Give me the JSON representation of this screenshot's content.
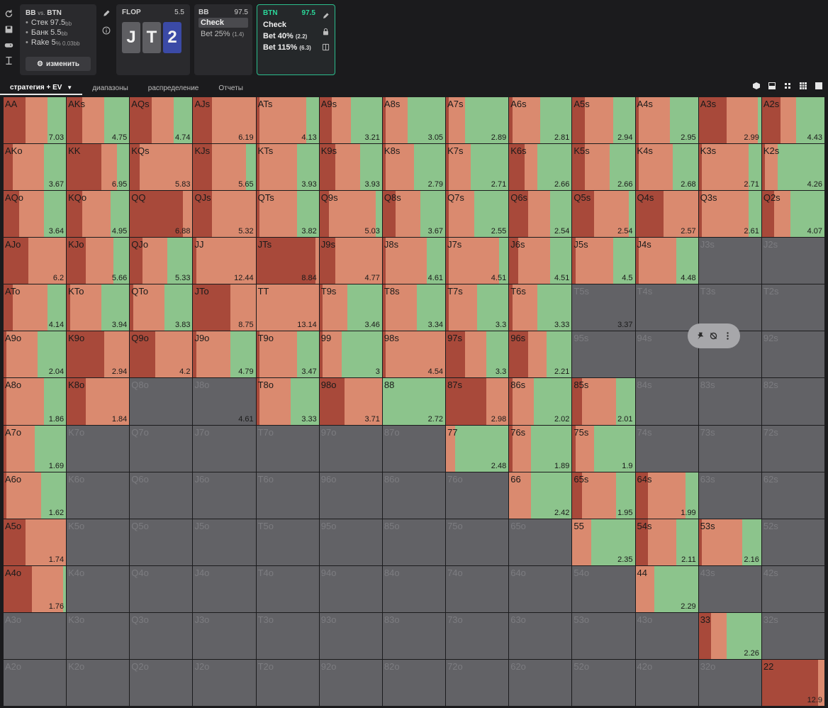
{
  "game": {
    "title": "BB",
    "title_sep": "vs.",
    "title_end": "BTN",
    "lines": [
      {
        "label": "Стек 97.5",
        "unit": "bb"
      },
      {
        "label": "Банк 5.5",
        "unit": "bb"
      },
      {
        "label": "Rake 5",
        "unit": "% 0.03bb"
      }
    ],
    "edit_label": "изменить"
  },
  "flop": {
    "label": "FLOP",
    "pot": "5.5",
    "cards": [
      {
        "rank": "J",
        "suit": "none"
      },
      {
        "rank": "T",
        "suit": "none"
      },
      {
        "rank": "2",
        "suit": "diamond"
      }
    ]
  },
  "bb_node": {
    "label": "BB",
    "stack": "97.5",
    "actions": [
      {
        "label": "Check",
        "size": "",
        "active": true
      },
      {
        "label": "Bet 25%",
        "size": "(1.4)",
        "active": false
      }
    ]
  },
  "btn_node": {
    "label": "BTN",
    "stack": "97.5",
    "actions": [
      {
        "label": "Check",
        "size": ""
      },
      {
        "label": "Bet 40%",
        "size": "(2.2)"
      },
      {
        "label": "Bet 115%",
        "size": "(6.3)"
      }
    ]
  },
  "tabs": [
    {
      "label": "стратегия + EV",
      "active": true
    },
    {
      "label": "диапазоны",
      "active": false
    },
    {
      "label": "распределение",
      "active": false
    },
    {
      "label": "Отчеты",
      "active": false
    }
  ],
  "colors": {
    "bet115": "#a8493a",
    "bet40": "#da8a6f",
    "check": "#8cc48c",
    "excluded": "#626266",
    "accent": "#2bbd8c"
  },
  "grid": {
    "rows": [
      [
        "AA|7.03|0.35,0.35,0.30",
        "AKs|4.75|0.25,0.35,0.40",
        "AQs|4.74|0.35,0.35,0.30",
        "AJs|6.19|0.30,0.70,0.0",
        "ATs|4.13|0.05,0.75,0.20",
        "A9s|3.21|0.20,0.30,0.50",
        "A8s|3.05|0.05,0.35,0.60",
        "A7s|2.89|0.05,0.25,0.70",
        "A6s|2.81|0.05,0.45,0.50",
        "A5s|2.94|0.20,0.45,0.35",
        "A4s|2.95|0.05,0.50,0.45",
        "A3s|2.99|0.45,0.50,0.05",
        "A2s|4.43|0.30,0.25,0.45"
      ],
      [
        "AKo|3.67|0.15,0.50,0.35",
        "KK|6.95|0.55,0.25,0.20",
        "KQs|5.83|0.15,0.85,0.0",
        "KJs|5.65|0.30,0.55,0.15",
        "KTs|3.93|0.05,0.60,0.35",
        "K9s|3.93|0.25,0.40,0.35",
        "K8s|2.79|0.05,0.45,0.50",
        "K7s|2.71|0.05,0.35,0.60",
        "K6s|2.66|0.25,0.20,0.55",
        "K5s|2.66|0.20,0.40,0.40",
        "K4s|2.68|0.05,0.55,0.40",
        "K3s|2.71|0.05,0.75,0.20",
        "K2s|4.26|0.05,0.20,0.75"
      ],
      [
        "AQo|3.64|0.25,0.40,0.35",
        "KQo|4.95|0.25,0.45,0.30",
        "QQ|6.88|0.85,0.15,0.0",
        "QJs|5.32|0.30,0.70,0.0",
        "QTs|3.82|0.05,0.60,0.35",
        "Q9s|5.03|0.15,0.75,0.10",
        "Q8s|3.67|0.20,0.40,0.40",
        "Q7s|2.55|0.05,0.40,0.55",
        "Q6s|2.54|0.30,0.35,0.35",
        "Q5s|2.54|0.35,0.55,0.10",
        "Q4s|2.57|0.45,0.55,0.0",
        "Q3s|2.61|0.05,0.75,0.20",
        "Q2s|4.07|0.20,0.25,0.55"
      ],
      [
        "AJo|6.2|0.40,0.60,0.0",
        "KJo|5.66|0.30,0.45,0.25",
        "QJo|5.33|0.20,0.40,0.40",
        "JJ|12.44|0.05,0.95,0.0",
        "JTs|8.84|0.95,0.05,0.0",
        "J9s|4.77|0.25,0.75,0.0",
        "J8s|4.61|0.05,0.65,0.30",
        "J7s|4.51|0.05,0.80,0.15",
        "J6s|4.51|0.15,0.50,0.35",
        "J5s|4.5|0.05,0.60,0.35",
        "J4s|4.48|0.05,0.60,0.35",
        "J3s||off",
        "J2s||off"
      ],
      [
        "ATo|4.14|0.15,0.55,0.30",
        "KTo|3.94|0.05,0.50,0.45",
        "QTo|3.83|0.05,0.50,0.45",
        "JTo|8.75|0.60,0.40,0.0",
        "TT|13.14|0.0,1.0,0.0",
        "T9s|3.46|0.05,0.40,0.55",
        "T8s|3.34|0.05,0.50,0.45",
        "T7s|3.3|0.05,0.45,0.50",
        "T6s|3.33|0.05,0.40,0.55",
        "T5s|3.37|off",
        "T4s||off",
        "T3s||off",
        "T2s||off"
      ],
      [
        "A9o|2.04|0.05,0.50,0.45",
        "K9o|2.94|0.60,0.40,0.0",
        "Q9o|4.2|0.40,0.60,0.0",
        "J9o|4.79|0.05,0.55,0.40",
        "T9o|3.47|0.05,0.60,0.35",
        "99|3|0.05,0.30,0.65",
        "98s|4.54|0.05,0.95,0.0",
        "97s|3.3|0.30,0.35,0.35",
        "96s|2.21|0.30,0.30,0.40",
        "95s||off",
        "94s||off",
        "93s||off",
        "92s||off"
      ],
      [
        "A8o|1.86|0.05,0.60,0.35",
        "K8o|1.84|0.30,0.70,0.0",
        "Q8o||off",
        "J8o|4.61|off",
        "T8o|3.33|0.05,0.50,0.45",
        "98o|3.71|0.40,0.60,0.0",
        "88|2.72|0.0,0.0,1.0",
        "87s|2.98|0.65,0.35,0.0",
        "86s|2.02|0.05,0.35,0.60",
        "85s|2.01|0.15,0.55,0.30",
        "84s||off",
        "83s||off",
        "82s||off"
      ],
      [
        "A7o|1.69|0.05,0.45,0.50",
        "K7o||off",
        "Q7o||off",
        "J7o||off",
        "T7o||off",
        "97o||off",
        "87o||off",
        "77|2.48|0.0,0.15,0.85",
        "76s|1.89|0.05,0.30,0.65",
        "75s|1.9|0.05,0.30,0.65",
        "74s||off",
        "73s||off",
        "72s||off"
      ],
      [
        "A6o|1.62|0.05,0.55,0.40",
        "K6o||off",
        "Q6o||off",
        "J6o||off",
        "T6o||off",
        "96o||off",
        "86o||off",
        "76o||off",
        "66|2.42|0.0,0.35,0.65",
        "65s|1.95|0.15,0.55,0.30",
        "64s|1.99|0.20,0.60,0.20",
        "63s||off",
        "62s||off"
      ],
      [
        "A5o|1.74|0.35,0.65,0.0",
        "K5o||off",
        "Q5o||off",
        "J5o||off",
        "T5o||off",
        "95o||off",
        "85o||off",
        "75o||off",
        "65o||off",
        "55|2.35|0.0,0.30,0.70",
        "54s|2.11|0.20,0.45,0.35",
        "53s|2.16|0.05,0.65,0.30",
        "52s||off"
      ],
      [
        "A4o|1.76|0.45,0.50,0.05",
        "K4o||off",
        "Q4o||off",
        "J4o||off",
        "T4o||off",
        "94o||off",
        "84o||off",
        "74o||off",
        "64o||off",
        "54o||off",
        "44|2.29|0.0,0.30,0.70",
        "43s||off",
        "42s||off"
      ],
      [
        "A3o||off",
        "K3o||off",
        "Q3o||off",
        "J3o||off",
        "T3o||off",
        "93o||off",
        "83o||off",
        "73o||off",
        "63o||off",
        "53o||off",
        "43o||off",
        "33|2.26|0.20,0.25,0.55",
        "32s||off"
      ],
      [
        "A2o||off",
        "K2o||off",
        "Q2o||off",
        "J2o||off",
        "T2o||off",
        "92o||off",
        "82o||off",
        "72o||off",
        "62o||off",
        "52o||off",
        "42o||off",
        "32o||off",
        "22|12.9|0.90,0.10,0.0"
      ]
    ]
  }
}
